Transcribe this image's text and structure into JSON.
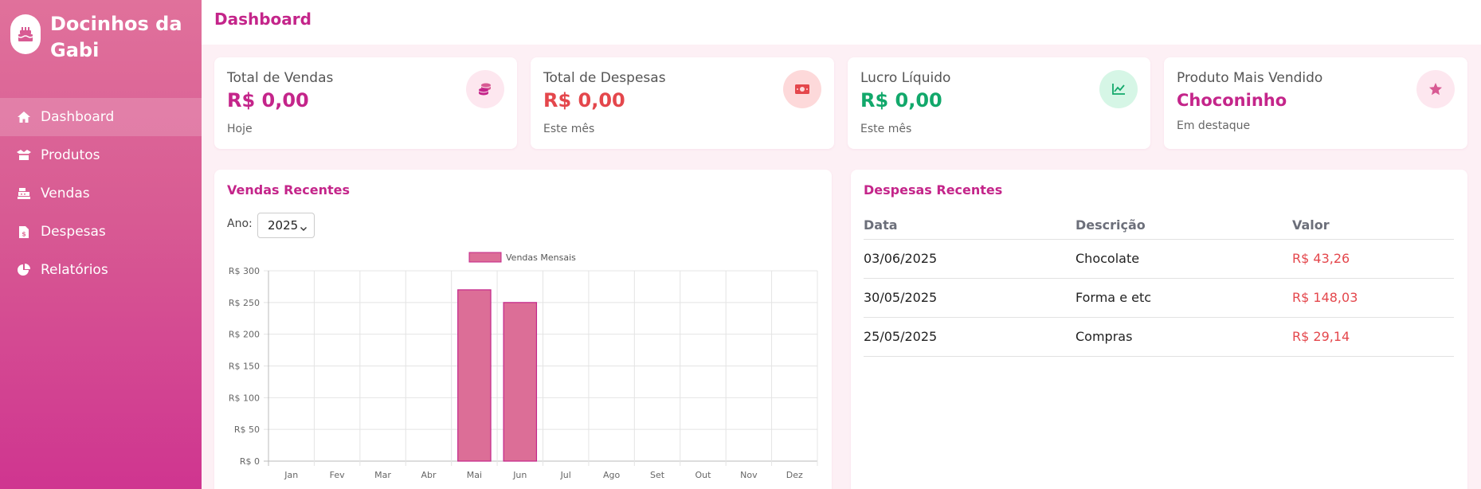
{
  "brand": {
    "title": "Docinhos da Gabi",
    "icon": "cake-icon"
  },
  "sidebar": {
    "items": [
      {
        "label": "Dashboard",
        "icon": "home-icon",
        "active": true
      },
      {
        "label": "Produtos",
        "icon": "box-icon",
        "active": false
      },
      {
        "label": "Vendas",
        "icon": "cash-register-icon",
        "active": false
      },
      {
        "label": "Despesas",
        "icon": "file-invoice-icon",
        "active": false
      },
      {
        "label": "Relatórios",
        "icon": "pie-chart-icon",
        "active": false
      }
    ]
  },
  "header": {
    "title": "Dashboard"
  },
  "stats": [
    {
      "title": "Total de Vendas",
      "value": "R$ 0,00",
      "sub": "Hoje",
      "color": "#c4258a",
      "icon": "coins-icon"
    },
    {
      "title": "Total de Despesas",
      "value": "R$ 0,00",
      "sub": "Este mês",
      "color": "#e4474c",
      "icon": "money-bill-icon"
    },
    {
      "title": "Lucro Líquido",
      "value": "R$ 0,00",
      "sub": "Este mês",
      "color": "#12a86b",
      "icon": "chart-line-icon"
    },
    {
      "title": "Produto Mais Vendido",
      "value": "Choconinho",
      "sub": "Em destaque",
      "color": "#c4258a",
      "icon": "star-icon"
    }
  ],
  "sales": {
    "title": "Vendas Recentes",
    "year_label": "Ano:",
    "year": "2025"
  },
  "expenses": {
    "title": "Despesas Recentes",
    "headers": [
      "Data",
      "Descrição",
      "Valor"
    ],
    "rows": [
      [
        "03/06/2025",
        "Chocolate",
        "R$ 43,26"
      ],
      [
        "30/05/2025",
        "Forma e etc",
        "R$ 148,03"
      ],
      [
        "25/05/2025",
        "Compras",
        "R$ 29,14"
      ]
    ]
  },
  "chart_data": {
    "type": "bar",
    "categories": [
      "Jan",
      "Fev",
      "Mar",
      "Abr",
      "Mai",
      "Jun",
      "Jul",
      "Ago",
      "Set",
      "Out",
      "Nov",
      "Dez"
    ],
    "series": [
      {
        "name": "Vendas Mensais",
        "values": [
          0,
          0,
          0,
          0,
          270,
          250,
          0,
          0,
          0,
          0,
          0,
          0
        ]
      }
    ],
    "ytick_labels": [
      "R$ 0",
      "R$ 50",
      "R$ 100",
      "R$ 150",
      "R$ 200",
      "R$ 250",
      "R$ 300"
    ],
    "ylim": [
      0,
      300
    ],
    "grid": true,
    "legend": "top",
    "bar_color": "#dc6e97",
    "bar_border": "#c4258a"
  }
}
